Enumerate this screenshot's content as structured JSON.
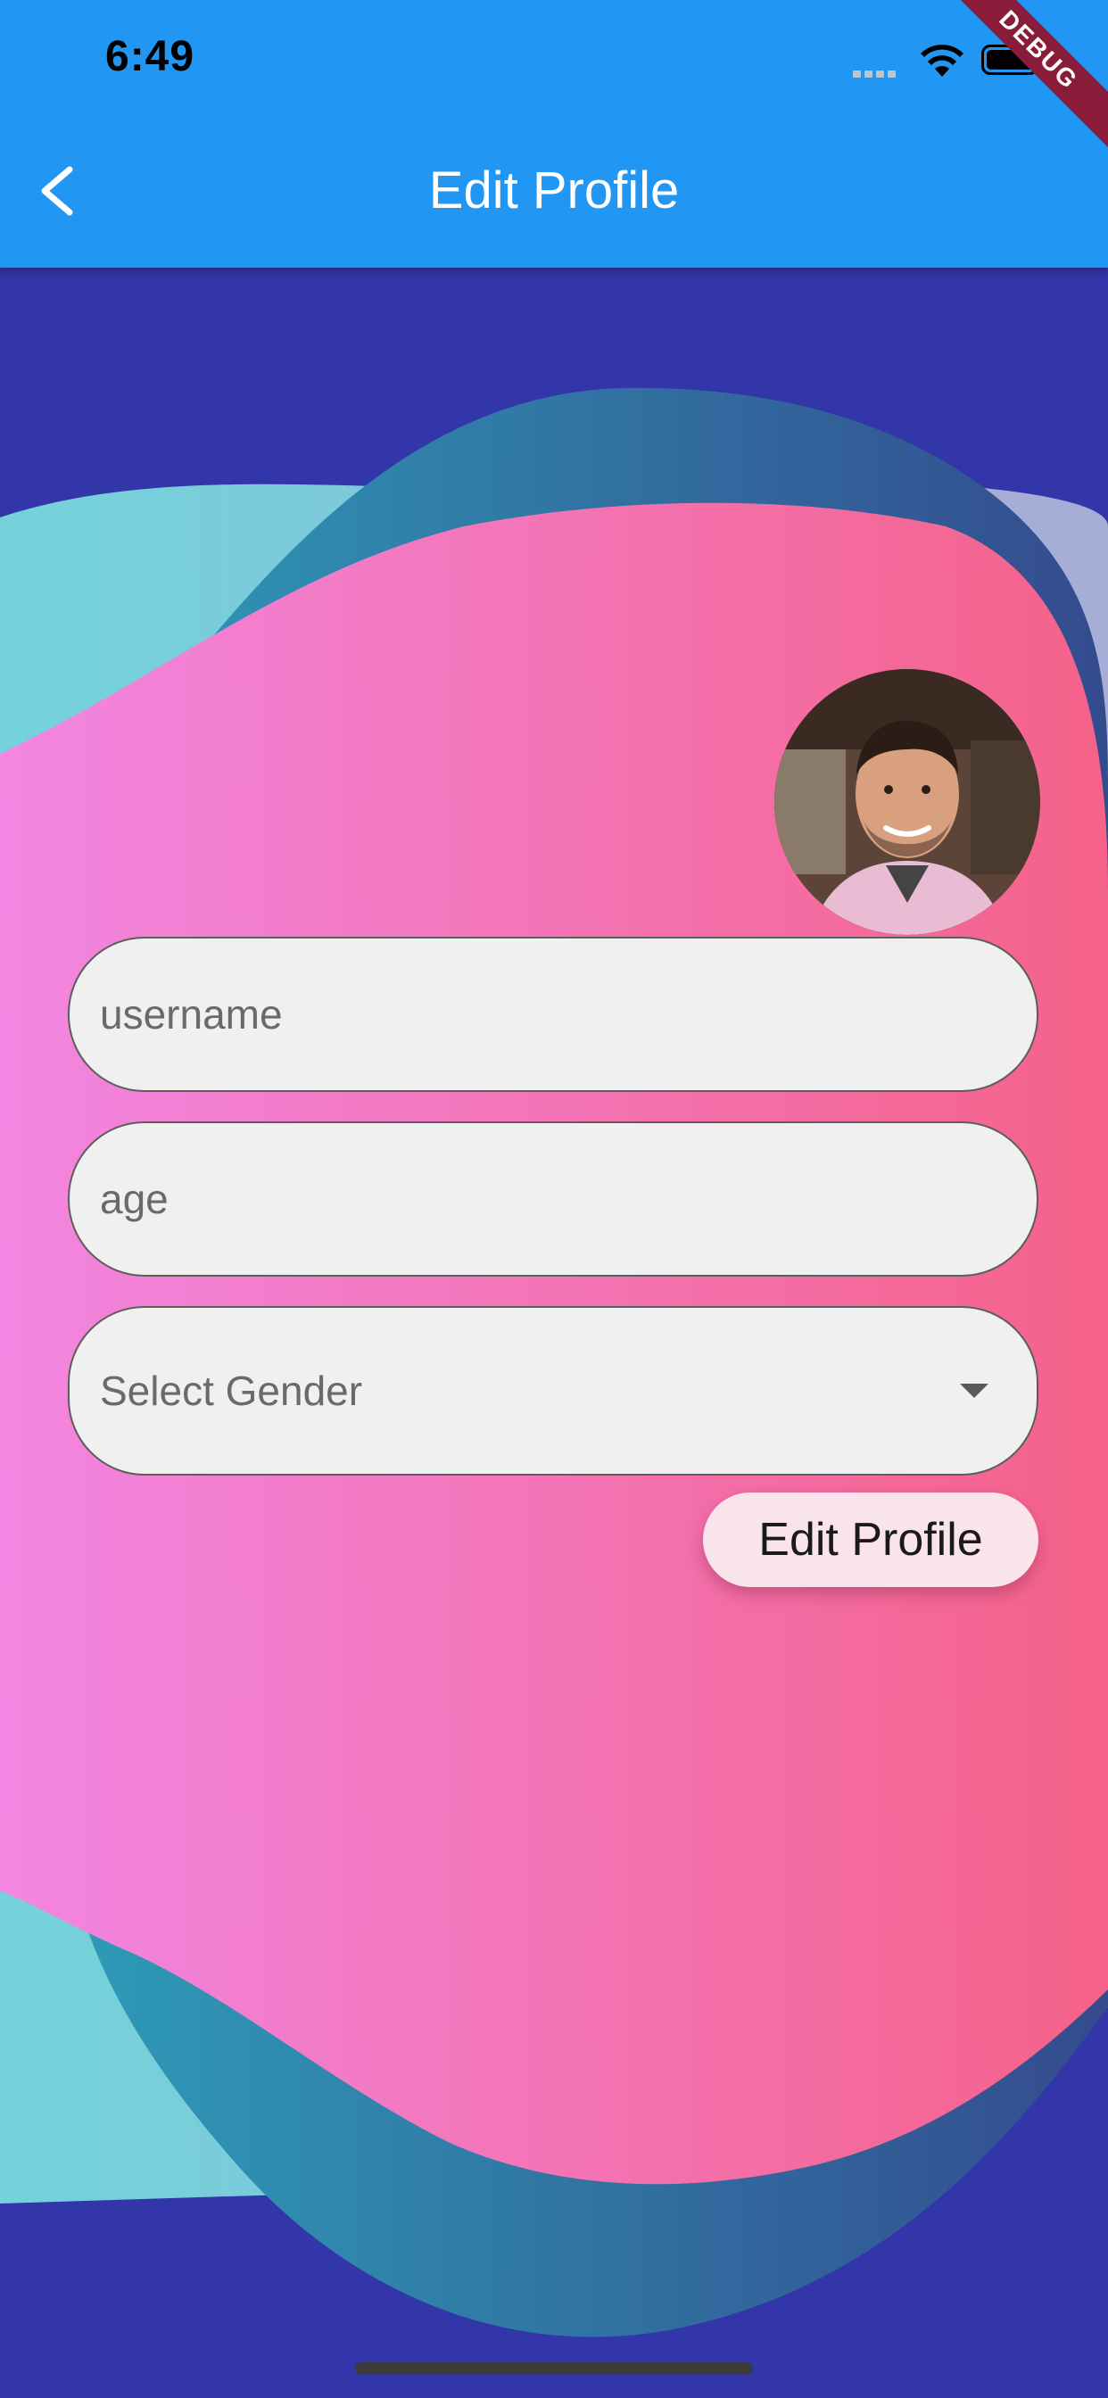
{
  "status_bar": {
    "time": "6:49",
    "debug_label": "DEBUG"
  },
  "app_bar": {
    "title": "Edit Profile",
    "back_icon": "chevron-left-icon"
  },
  "form": {
    "username_placeholder": "username",
    "age_placeholder": "age",
    "gender_placeholder": "Select Gender",
    "submit_label": "Edit Profile"
  },
  "colors": {
    "app_bar": "#2196F3",
    "background": "#3236A8",
    "blob_pink_left": "#F286E2",
    "blob_pink_right": "#F56289",
    "blob_teal": "#74D2DB",
    "button_bg": "#F9E4EC"
  }
}
